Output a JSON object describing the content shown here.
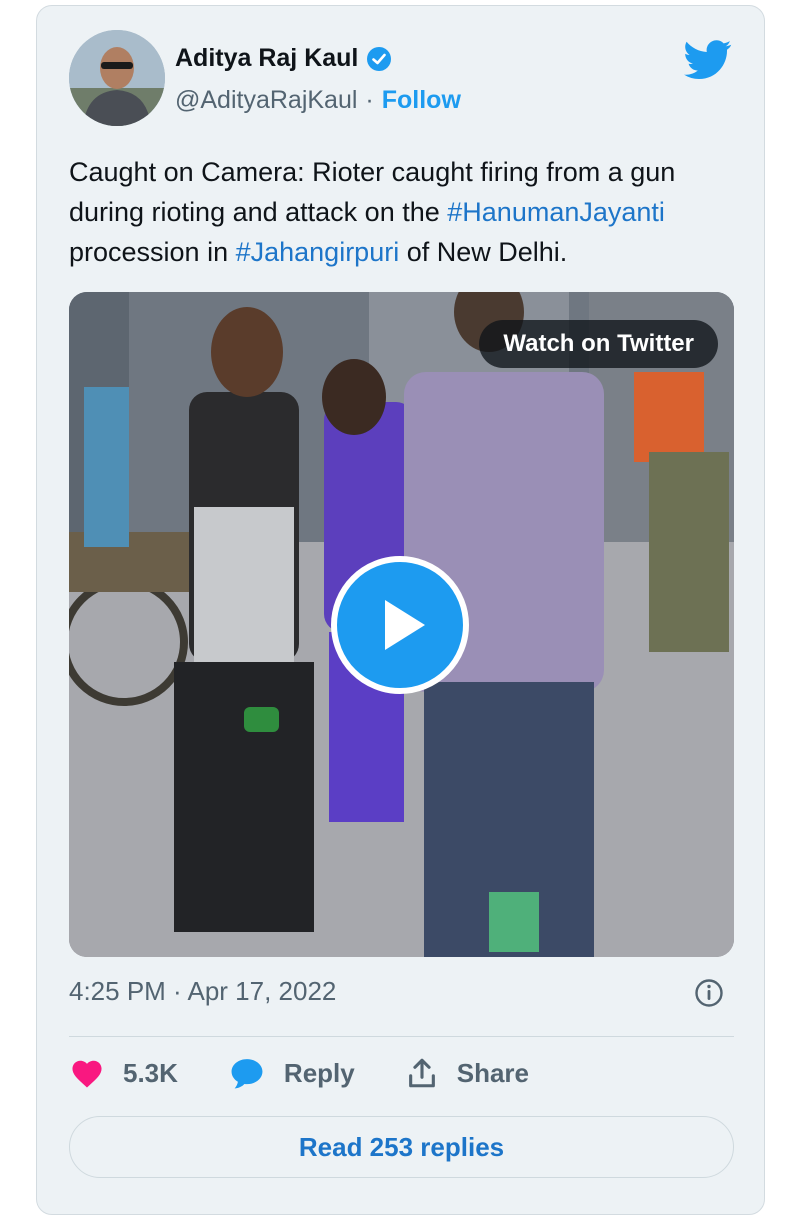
{
  "tweet": {
    "author_name": "Aditya Raj Kaul",
    "handle": "@AdityaRajKaul",
    "separator": "·",
    "follow_label": "Follow",
    "text_part1": "Caught on Camera: Rioter caught firing from a gun during rioting and attack on the ",
    "hashtag1": "#HanumanJayanti",
    "text_part2": " procession in ",
    "hashtag2": "#Jahangirpuri",
    "text_part3": " of New Delhi.",
    "media_overlay": "Watch on Twitter",
    "timestamp": "4:25 PM · Apr 17, 2022",
    "likes": "5.3K",
    "reply_label": "Reply",
    "share_label": "Share",
    "read_replies": "Read 253 replies"
  },
  "colors": {
    "accent": "#1d9bf0",
    "link": "#1d75c9",
    "heart": "#f91880",
    "card_bg": "#edf2f5"
  },
  "icons": [
    "verified-badge-icon",
    "twitter-bird-icon",
    "play-icon",
    "info-icon",
    "heart-icon",
    "reply-bubble-icon",
    "share-icon"
  ]
}
